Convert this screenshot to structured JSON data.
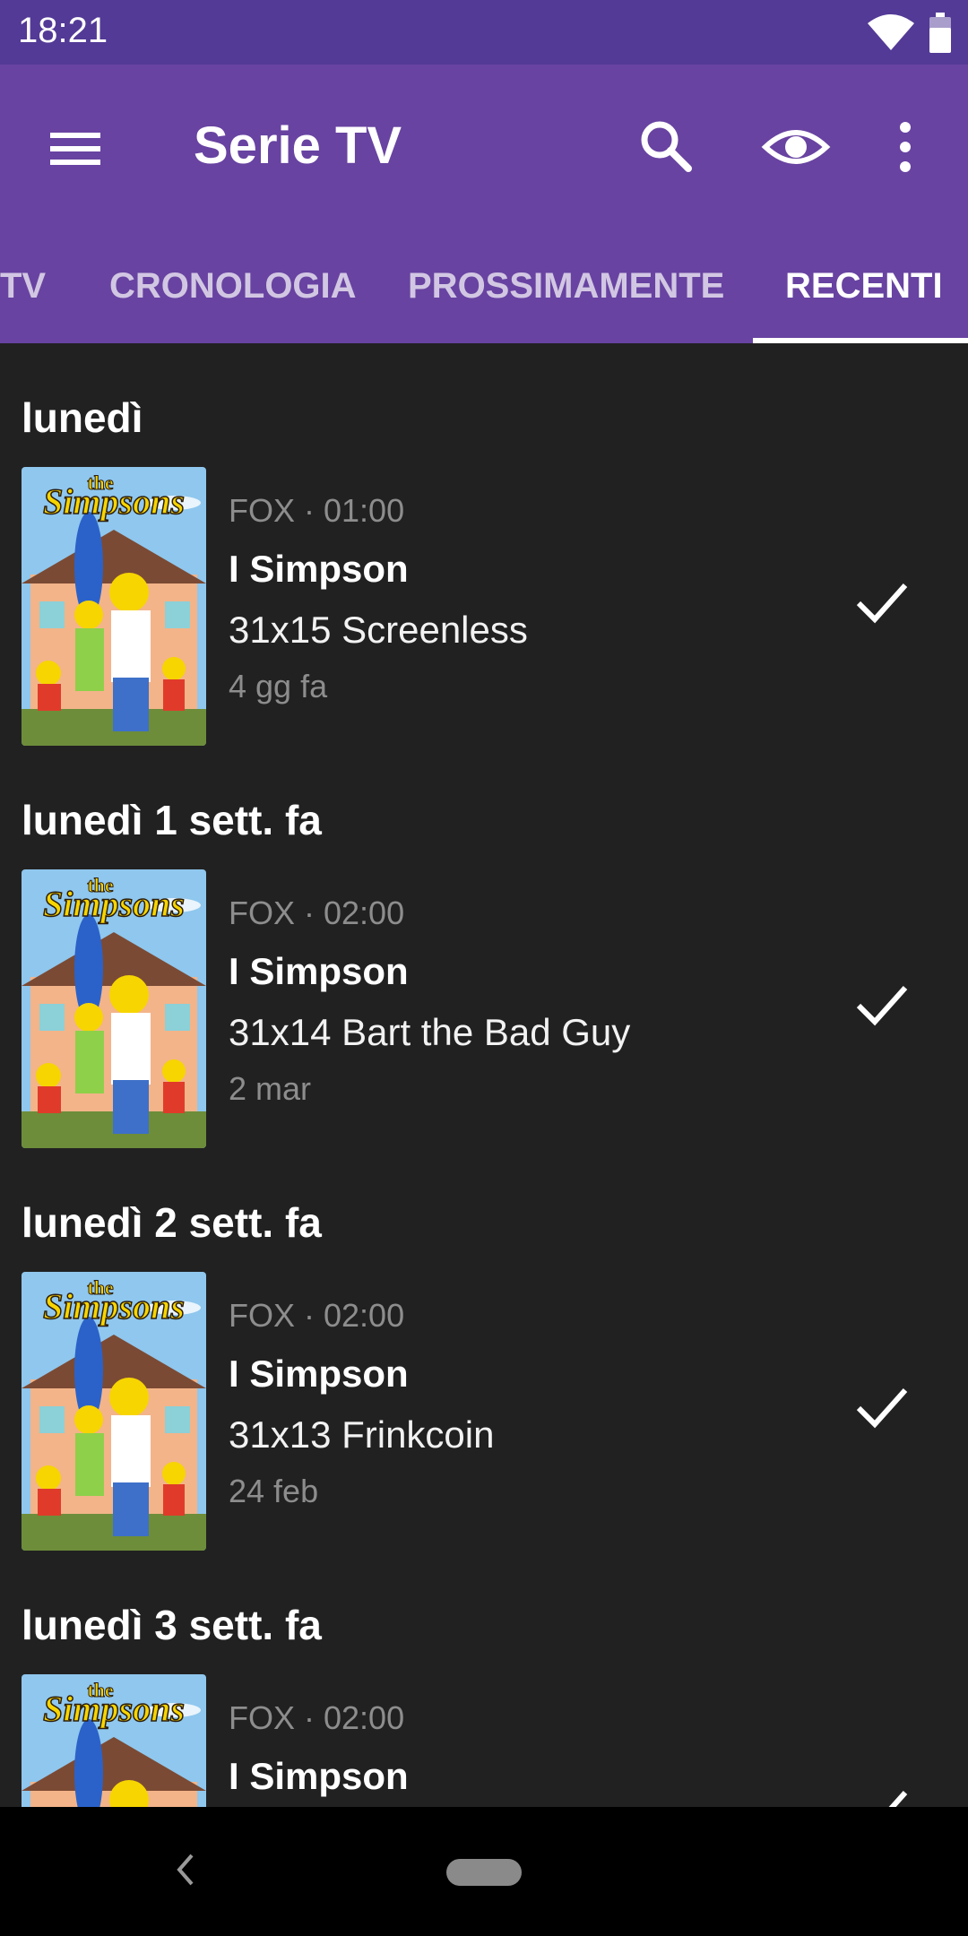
{
  "status_bar": {
    "time": "18:21"
  },
  "app_bar": {
    "title": "Serie TV",
    "accent_color": "#6843a1"
  },
  "tabs": [
    {
      "label": "TV"
    },
    {
      "label": "CRONOLOGIA"
    },
    {
      "label": "PROSSIMAMENTE"
    },
    {
      "label": "RECENTI",
      "active": true
    }
  ],
  "sections": [
    {
      "title": "lunedì",
      "item": {
        "meta": "FOX · 01:00",
        "show": "I Simpson",
        "episode": "31x15 Screenless",
        "ago": "4 gg fa",
        "watched": true
      }
    },
    {
      "title": "lunedì 1 sett. fa",
      "item": {
        "meta": "FOX · 02:00",
        "show": "I Simpson",
        "episode": "31x14 Bart the Bad Guy",
        "ago": "2 mar",
        "watched": true
      }
    },
    {
      "title": "lunedì 2 sett. fa",
      "item": {
        "meta": "FOX · 02:00",
        "show": "I Simpson",
        "episode": "31x13 Frinkcoin",
        "ago": "24 feb",
        "watched": true
      }
    },
    {
      "title": "lunedì 3 sett. fa",
      "item": {
        "meta": "FOX · 02:00",
        "show": "I Simpson",
        "watched": true
      }
    }
  ],
  "poster_logo_text": "THE SIMPSONS"
}
